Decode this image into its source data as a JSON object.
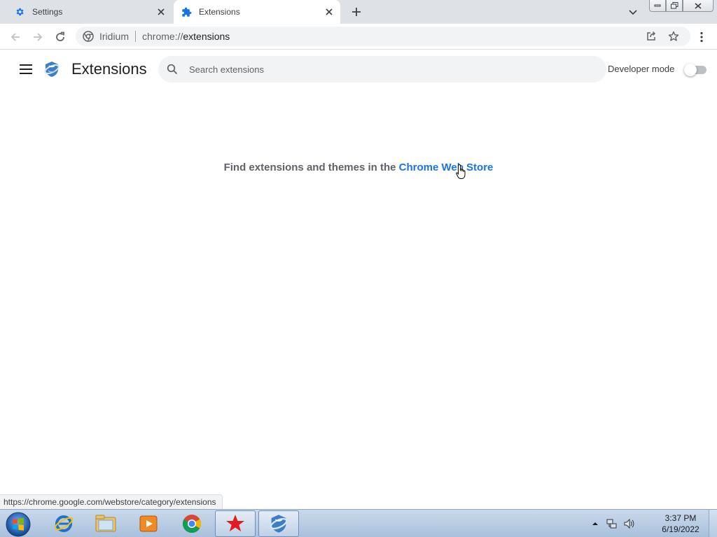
{
  "tabs": [
    {
      "label": "Settings",
      "icon": "gear-icon",
      "active": false
    },
    {
      "label": "Extensions",
      "icon": "puzzle-icon",
      "active": true
    }
  ],
  "toolbar": {
    "site_name": "Iridium",
    "url_scheme": "chrome://",
    "url_host": "extensions"
  },
  "extensions_page": {
    "title": "Extensions",
    "search_placeholder": "Search extensions",
    "developer_mode_label": "Developer mode",
    "developer_mode_on": false,
    "empty_text": "Find extensions and themes in the ",
    "store_link_text": "Chrome Web Store"
  },
  "status_bar": {
    "url": "https://chrome.google.com/webstore/category/extensions"
  },
  "taskbar": {
    "items": [
      "internet-explorer-icon",
      "file-explorer-icon",
      "media-player-icon",
      "chrome-icon",
      "red-star-app-icon",
      "iridium-browser-icon"
    ],
    "clock_time": "3:37 PM",
    "clock_date": "6/19/2022"
  },
  "colors": {
    "accent_blue": "#1a73e8",
    "tabstrip_bg": "#dee1e6",
    "omnibox_bg": "#f1f3f4"
  }
}
